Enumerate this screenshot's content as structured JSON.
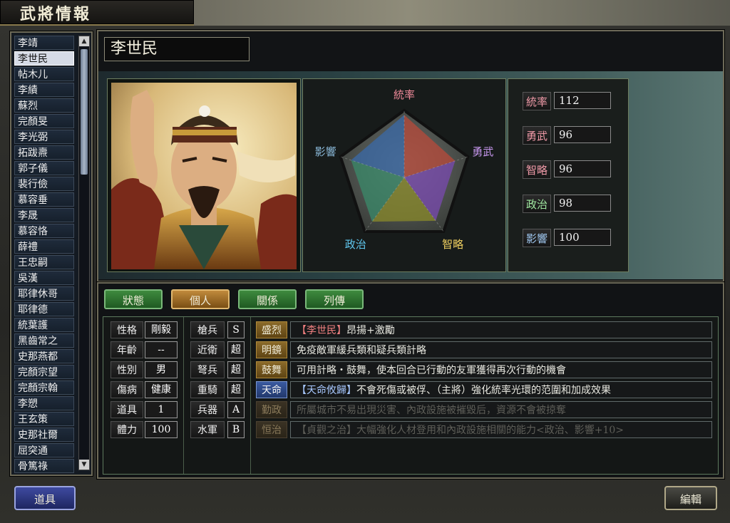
{
  "header": {
    "title": "武將情報"
  },
  "officer_list": {
    "selected_index": 1,
    "names": [
      "李靖",
      "李世民",
      "帖木儿",
      "李績",
      "蘇烈",
      "完顏旻",
      "李光弼",
      "拓跋燾",
      "郭子儀",
      "裴行儉",
      "慕容垂",
      "李晟",
      "慕容恪",
      "薛禮",
      "王忠嗣",
      "吳漢",
      "耶律休哥",
      "耶律德",
      "統葉護",
      "黑齒常之",
      "史那燕都",
      "完顏宗望",
      "完顏宗翰",
      "李愬",
      "王玄策",
      "史那社爾",
      "屈突通",
      "骨篤祿"
    ]
  },
  "officer": {
    "name": "李世民"
  },
  "radar": {
    "labels": [
      "統率",
      "勇武",
      "智略",
      "政治",
      "影響"
    ],
    "values": [
      112,
      96,
      96,
      98,
      100
    ],
    "max": 120,
    "label_colors": [
      "#f08a9a",
      "#c898f0",
      "#f0d060",
      "#60c8f0",
      "#8ab8d8"
    ]
  },
  "stats": [
    {
      "label": "統率",
      "value": "112"
    },
    {
      "label": "勇武",
      "value": "96"
    },
    {
      "label": "智略",
      "value": "96"
    },
    {
      "label": "政治",
      "value": "98"
    },
    {
      "label": "影響",
      "value": "100"
    }
  ],
  "stat_label_colors": [
    "#f09aa8",
    "#f09aa8",
    "#f09aa8",
    "#a0e8a0",
    "#a0c8f0"
  ],
  "tabs": [
    {
      "label": "狀態",
      "active": false
    },
    {
      "label": "個人",
      "active": true
    },
    {
      "label": "關係",
      "active": false
    },
    {
      "label": "列傳",
      "active": false
    }
  ],
  "attributes": [
    {
      "label": "性格",
      "value": "剛毅"
    },
    {
      "label": "年齡",
      "value": "--"
    },
    {
      "label": "性別",
      "value": "男"
    },
    {
      "label": "傷病",
      "value": "健康"
    },
    {
      "label": "道具",
      "value": "1"
    },
    {
      "label": "體力",
      "value": "100"
    }
  ],
  "aptitudes": [
    {
      "label": "槍兵",
      "value": "S"
    },
    {
      "label": "近衛",
      "value": "超"
    },
    {
      "label": "弩兵",
      "value": "超"
    },
    {
      "label": "重騎",
      "value": "超"
    },
    {
      "label": "兵器",
      "value": "A"
    },
    {
      "label": "水軍",
      "value": "B"
    }
  ],
  "skills": [
    {
      "name": "盛烈",
      "style": "gold",
      "desc_prefix": "【李世民】",
      "desc": "昂揚+激勵",
      "dim": false
    },
    {
      "name": "明鏡",
      "style": "gold",
      "desc_prefix": "",
      "desc": "免疫敵軍緩兵類和疑兵類計略",
      "dim": false
    },
    {
      "name": "鼓舞",
      "style": "gold",
      "desc_prefix": "",
      "desc": "可用計略・鼓舞，使本回合已行動的友軍獲得再次行動的機會",
      "dim": false
    },
    {
      "name": "天命",
      "style": "blue",
      "desc_prefix": "【天命攸歸】",
      "desc": "不會死傷或被俘、（主將）強化統率光環的范圍和加成效果",
      "dim": false
    },
    {
      "name": "勤政",
      "style": "dim",
      "desc_prefix": "",
      "desc": "所屬城市不易出現災害、內政設施被摧毀后，資源不會被掠奪",
      "dim": true
    },
    {
      "name": "恒治",
      "style": "dim",
      "desc_prefix": "【貞觀之治】",
      "desc": "大幅強化人材登用和內政設施相關的能力<政治、影響+10>",
      "dim": true
    }
  ],
  "buttons": {
    "items": "道具",
    "edit": "編輯"
  }
}
